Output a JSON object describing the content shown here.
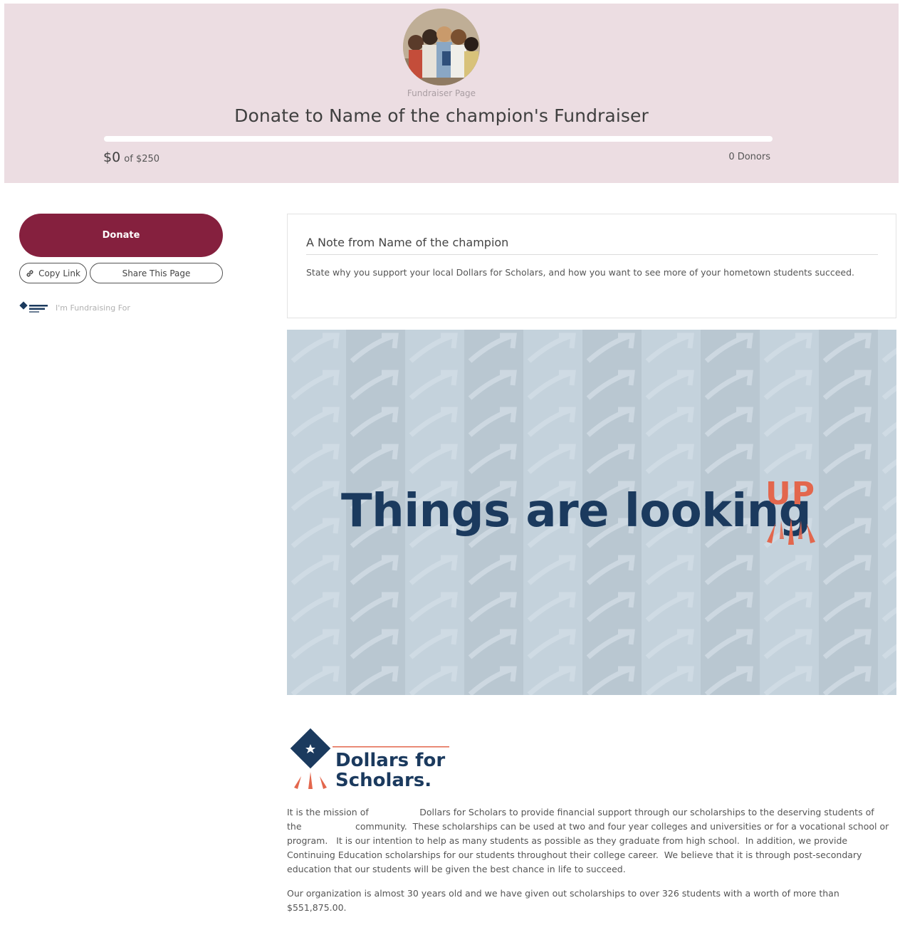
{
  "header": {
    "label": "Fundraiser Page",
    "title": "Donate to Name of the champion's Fundraiser",
    "raised_amount": "$0",
    "goal_text": "of $250",
    "progress_fraction": 0,
    "donors_text": "0 Donors",
    "avatar": "group-of-students-photo"
  },
  "sidebar": {
    "donate_label": "Donate",
    "copy_link_label": "Copy Link",
    "share_label": "Share This Page",
    "fundraising_for_label": "I'm Fundraising For",
    "copy_link_icon": "link-icon"
  },
  "note": {
    "title": "A Note from Name of the champion",
    "body": "State why you support your local Dollars for Scholars, and how you want to see more of your hometown students succeed."
  },
  "banner": {
    "text": "Things are looking",
    "highlight": "UP"
  },
  "organization": {
    "name_line1": "Dollars for",
    "name_line2": "Scholars.",
    "paragraph1": "It is the mission of                  Dollars for Scholars to provide financial support through our scholarships to the deserving students of the                   community.  These scholarships can be used at two and four year colleges and universities or for a vocational school or program.   It is our intention to help as many students as possible as they graduate from high school.  In addition, we provide Continuing Education scholarships for our students throughout their college career.  We believe that it is through post-secondary education that our students will be given the best chance in life to succeed.",
    "paragraph2": "Our organization is almost 30 years old and we have given out scholarships to over 326 students with a worth of more than $551,875.00."
  },
  "colors": {
    "hero_bg": "#ecdde2",
    "brand": "#85203e",
    "navy": "#1b3a5e",
    "accent_orange": "#e3674d",
    "banner_bg": "#c4d2dc"
  }
}
